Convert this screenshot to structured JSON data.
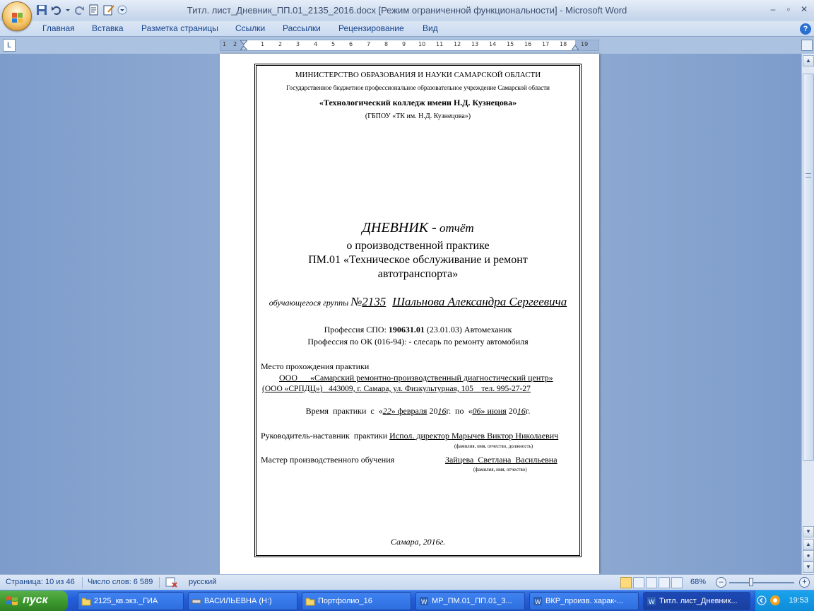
{
  "window": {
    "title": "Титл. лист_Дневник_ПП.01_2135_2016.docx [Режим ограниченной функциональности] - Microsoft Word",
    "minimize": "–",
    "maximize": "▫",
    "close": "✕"
  },
  "ribbon": {
    "tabs": [
      "Главная",
      "Вставка",
      "Разметка страницы",
      "Ссылки",
      "Рассылки",
      "Рецензирование",
      "Вид"
    ],
    "help": "?"
  },
  "ruler": {
    "ticks": [
      "1",
      "2",
      "1",
      "2",
      "3",
      "4",
      "5",
      "6",
      "7",
      "8",
      "9",
      "10",
      "11",
      "12",
      "13",
      "14",
      "15",
      "16",
      "17",
      "18",
      "19"
    ],
    "tab_selector": "L"
  },
  "document": {
    "ministry": "МИНИСТЕРСТВО ОБРАЗОВАНИЯ И НАУКИ САМАРСКОЙ ОБЛАСТИ",
    "institution": "Государственное бюджетное профессиональное образовательное учреждение Самарской области",
    "college": "«Технологический колледж имени Н.Д. Кузнецова»",
    "college_short": "(ГБПОУ «ТК им. Н.Д. Кузнецова»)",
    "title_main": "ДНЕВНИК -",
    "title_sub": " отчёт",
    "subtitle1": "о производственной практике",
    "subtitle2": "ПМ.01 «Техническое обслуживание и ремонт",
    "subtitle3": "автотранспорта»",
    "student_label": "обучающегося группы",
    "group_no_sign": "№",
    "group_number": "2135",
    "student_name": "Шальнова Александра Сергеевича",
    "profession_label": "Профессия СПО: ",
    "profession_code": "190631.01",
    "profession_rest": " (23.01.03) Автомеханик",
    "profession_ok": "Профессия по ОК (016-94):  - слесарь по ремонту автомобиля",
    "place_label": "Место прохождения практики",
    "place_line1": "ООО      «Самарский ремонтно-производственный диагностический центр»",
    "place_line2": "(ООО «СРПДЦ»)   443009, г. Самара, ул. Физкультурная, 105    тел. 995-27-27",
    "period_prefix": "Время  практики  с  «",
    "period_day1": "22",
    "period_mid1": "» февраля",
    "period_year1_a": " 20",
    "period_year1_b": "16",
    "period_g1": "г.  по  «",
    "period_day2": "06",
    "period_mid2": "» июня",
    "period_year2_a": " 20",
    "period_year2_b": "16",
    "period_g2": "г.",
    "mentor_label": "Руководитель-наставник  практики ",
    "mentor_value": "Испол. директор Марычев Виктор Николаевич",
    "mentor_hint": "(фамилия, имя, отчество, должность)",
    "master_label": "Мастер производственного обучения",
    "master_value": "Зайцева  Светлана  Васильевна",
    "master_hint": "(фамилия, имя, отчество)",
    "footer": "Самара, 2016г."
  },
  "statusbar": {
    "page": "Страница: 10 из 46",
    "words": "Число слов: 6 589",
    "language": "русский",
    "zoom": "68%",
    "zoom_level_percent": 68
  },
  "taskbar": {
    "start": "пуск",
    "tasks": [
      "2125_кв.экз._ГИА",
      "ВАСИЛЬЕВНА (H:)",
      "Портфолио_16",
      "МР_ПМ.01_ПП.01_3...",
      "ВКР_произв. харак-...",
      "Титл. лист_Дневник..."
    ],
    "clock": "19:53"
  },
  "colors": {
    "accent": "#15428b",
    "doc_background": "#8faad1",
    "taskbar": "#245edb",
    "start": "#3d9a2f"
  }
}
